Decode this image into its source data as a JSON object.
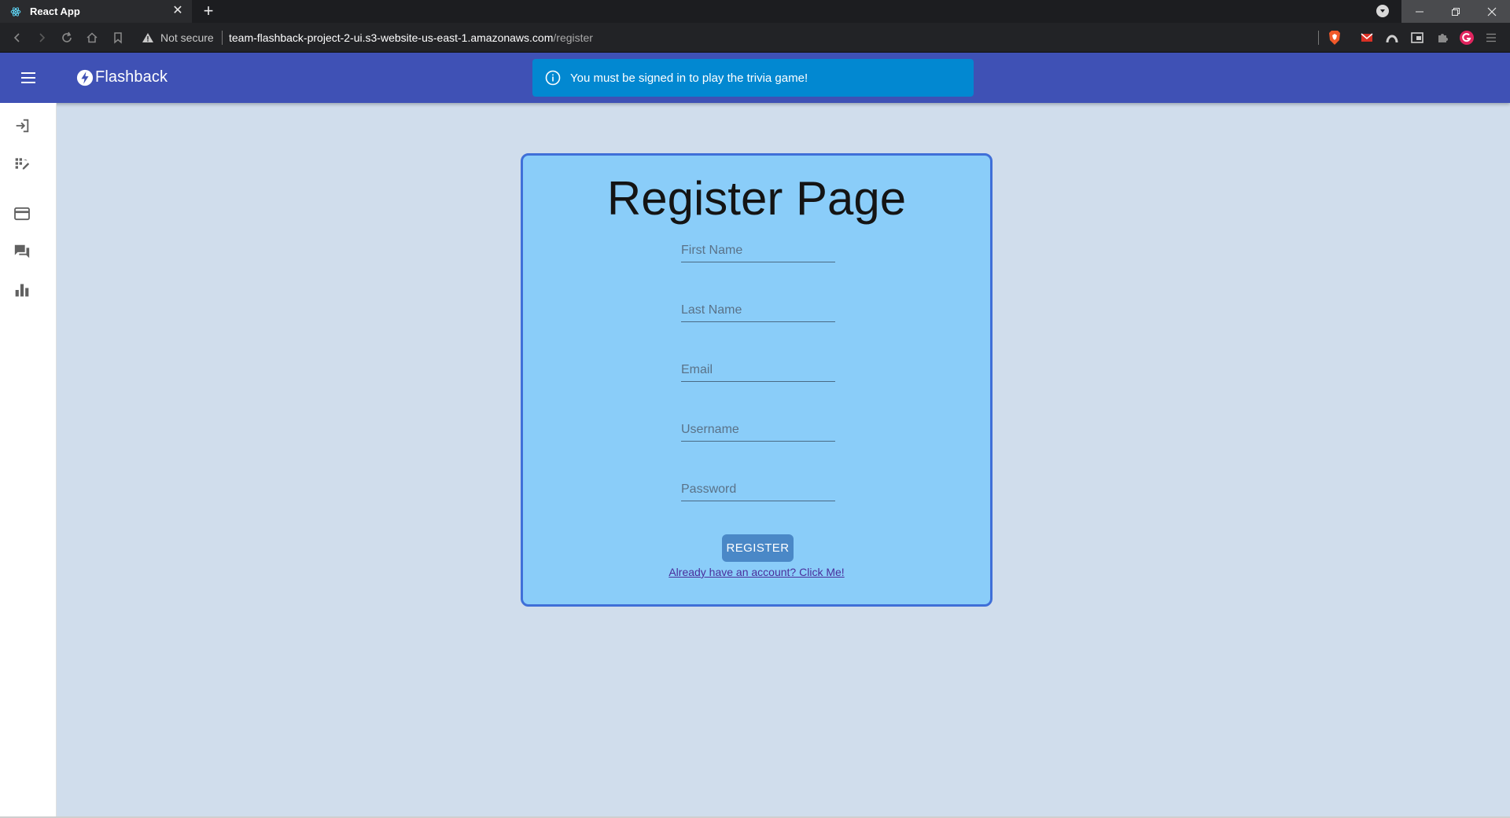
{
  "browser": {
    "tab_title": "React App",
    "security_text": "Not secure",
    "url_host": "team-flashback-project-2-ui.s3-website-us-east-1.amazonaws.com",
    "url_path": "/register"
  },
  "app": {
    "brand": "Flashback",
    "alert_message": "You must be signed in to play the trivia game!",
    "sidebar_items": [
      {
        "icon": "login-icon"
      },
      {
        "icon": "quiz-grid-icon"
      },
      {
        "icon": "credit-card-icon"
      },
      {
        "icon": "forum-icon"
      },
      {
        "icon": "bar-chart-icon"
      }
    ]
  },
  "register": {
    "title": "Register Page",
    "fields": {
      "first_name": {
        "placeholder": "First Name",
        "value": ""
      },
      "last_name": {
        "placeholder": "Last Name",
        "value": ""
      },
      "email": {
        "placeholder": "Email",
        "value": ""
      },
      "username": {
        "placeholder": "Username",
        "value": ""
      },
      "password": {
        "placeholder": "Password",
        "value": ""
      }
    },
    "submit_label": "REGISTER",
    "login_link": "Already have an account? Click Me!"
  },
  "colors": {
    "appbar": "#3f51b5",
    "alert": "#0288d1",
    "card_bg": "#8acdf9",
    "card_border": "#3f6fd8",
    "page_bg": "#d0ddec",
    "button": "#4a88c7"
  }
}
